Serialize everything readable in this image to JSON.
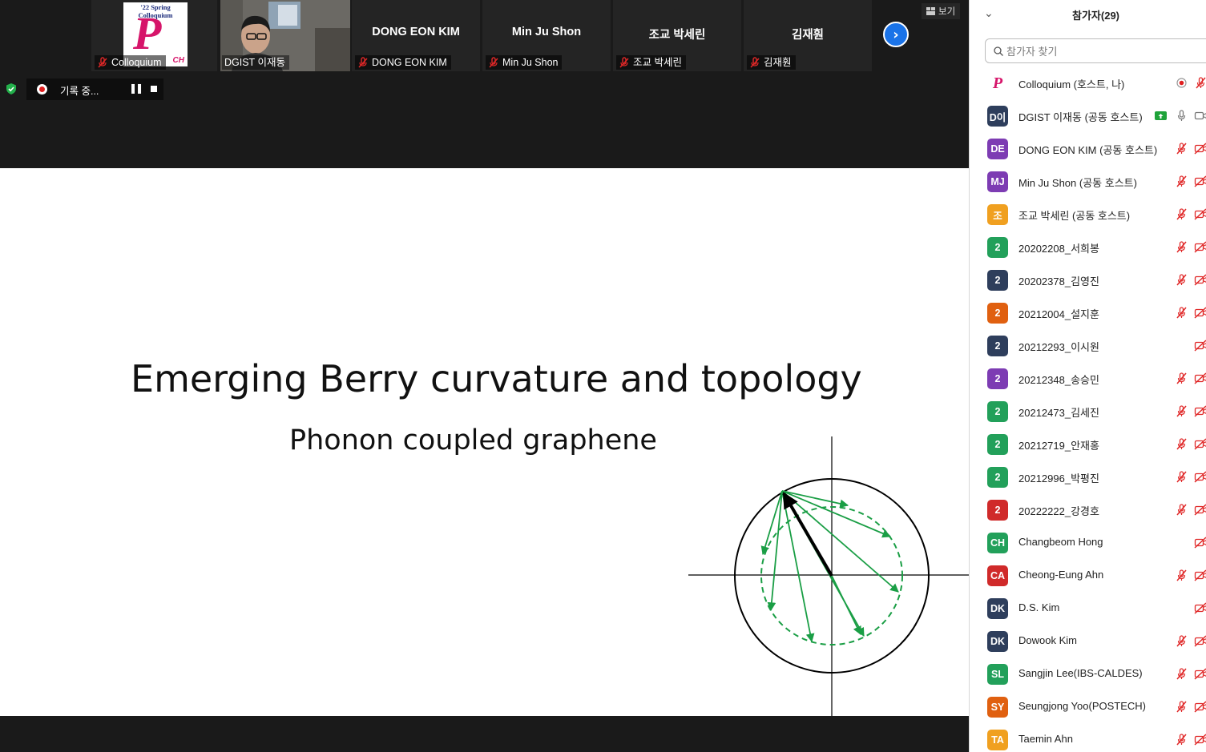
{
  "strip": {
    "tiles": [
      {
        "name": "Colloquium",
        "logo_caption": "'22 Spring Colloquium",
        "logo_letter": "P",
        "logo_frag": "CH"
      },
      {
        "name": "DGIST 이재동"
      },
      {
        "name": "DONG EON KIM",
        "big": "DONG EON KIM"
      },
      {
        "name": "Min Ju Shon",
        "big": "Min Ju Shon"
      },
      {
        "name": "조교 박세린",
        "big": "조교 박세린"
      },
      {
        "name": "김재훤",
        "big": "김재훤"
      }
    ],
    "view_label": "보기"
  },
  "recording": {
    "label": "기록 중..."
  },
  "slide": {
    "title": "Emerging Berry curvature and topology",
    "subtitle": "Phonon coupled graphene"
  },
  "panel": {
    "title": "참가자(29)",
    "search_placeholder": "참가자 찾기",
    "participants": [
      {
        "initials": "P",
        "logo": true,
        "name": "Colloquium (호스트, 나)",
        "color": "#ffffff",
        "icons": [
          "record",
          "mic-off-red"
        ]
      },
      {
        "initials": "D이",
        "name": "DGIST 이재동 (공동 호스트)",
        "color": "#2e3e5c",
        "icons": [
          "share",
          "mic",
          "cam"
        ]
      },
      {
        "initials": "DE",
        "name": "DONG EON KIM (공동 호스트)",
        "color": "#7d3cb3",
        "icons": [
          "mic-off-red",
          "cam-off-red"
        ]
      },
      {
        "initials": "MJ",
        "name": "Min Ju Shon (공동 호스트)",
        "color": "#7d3cb3",
        "icons": [
          "mic-off-red",
          "cam-off-red"
        ]
      },
      {
        "initials": "조",
        "name": "조교 박세린 (공동 호스트)",
        "color": "#f0a020",
        "icons": [
          "mic-off-red",
          "cam-off-red"
        ]
      },
      {
        "initials": "2",
        "name": "20202208_서희봉",
        "color": "#22a05a",
        "icons": [
          "mic-off-red",
          "cam-off-red"
        ]
      },
      {
        "initials": "2",
        "name": "20202378_김영진",
        "color": "#2e3e5c",
        "icons": [
          "mic-off-red",
          "cam-off-red"
        ]
      },
      {
        "initials": "2",
        "name": "20212004_설지훈",
        "color": "#e06010",
        "icons": [
          "mic-off-red",
          "cam-off-red"
        ]
      },
      {
        "initials": "2",
        "name": "20212293_이시원",
        "color": "#2e3e5c",
        "icons": [
          "cam-off-red"
        ]
      },
      {
        "initials": "2",
        "name": "20212348_송승민",
        "color": "#7d3cb3",
        "icons": [
          "mic-off-red",
          "cam-off-red"
        ]
      },
      {
        "initials": "2",
        "name": "20212473_김세진",
        "color": "#22a05a",
        "icons": [
          "mic-off-red",
          "cam-off-red"
        ]
      },
      {
        "initials": "2",
        "name": "20212719_안재홍",
        "color": "#22a05a",
        "icons": [
          "mic-off-red",
          "cam-off-red"
        ]
      },
      {
        "initials": "2",
        "name": "20212996_박평진",
        "color": "#22a05a",
        "icons": [
          "mic-off-red",
          "cam-off-red"
        ]
      },
      {
        "initials": "2",
        "name": "20222222_강경호",
        "color": "#d02a2a",
        "icons": [
          "mic-off-red",
          "cam-off-red"
        ]
      },
      {
        "initials": "CH",
        "name": "Changbeom Hong",
        "color": "#22a05a",
        "icons": [
          "cam-off-red"
        ]
      },
      {
        "initials": "CA",
        "name": "Cheong-Eung Ahn",
        "color": "#d02a2a",
        "icons": [
          "mic-off-red",
          "cam-off-red"
        ]
      },
      {
        "initials": "DK",
        "name": "D.S. Kim",
        "color": "#2e3e5c",
        "icons": [
          "cam-off-red"
        ]
      },
      {
        "initials": "DK",
        "name": "Dowook Kim",
        "color": "#2e3e5c",
        "icons": [
          "mic-off-red",
          "cam-off-red"
        ]
      },
      {
        "initials": "SL",
        "name": "Sangjin Lee(IBS-CALDES)",
        "color": "#22a05a",
        "icons": [
          "mic-off-red",
          "cam-off-red"
        ]
      },
      {
        "initials": "SY",
        "name": "Seungjong Yoo(POSTECH)",
        "color": "#e06010",
        "icons": [
          "mic-off-red",
          "cam-off-red"
        ]
      },
      {
        "initials": "TA",
        "name": "Taemin Ahn",
        "color": "#f0a020",
        "icons": [
          "mic-off-red",
          "cam-off-red"
        ]
      }
    ]
  }
}
